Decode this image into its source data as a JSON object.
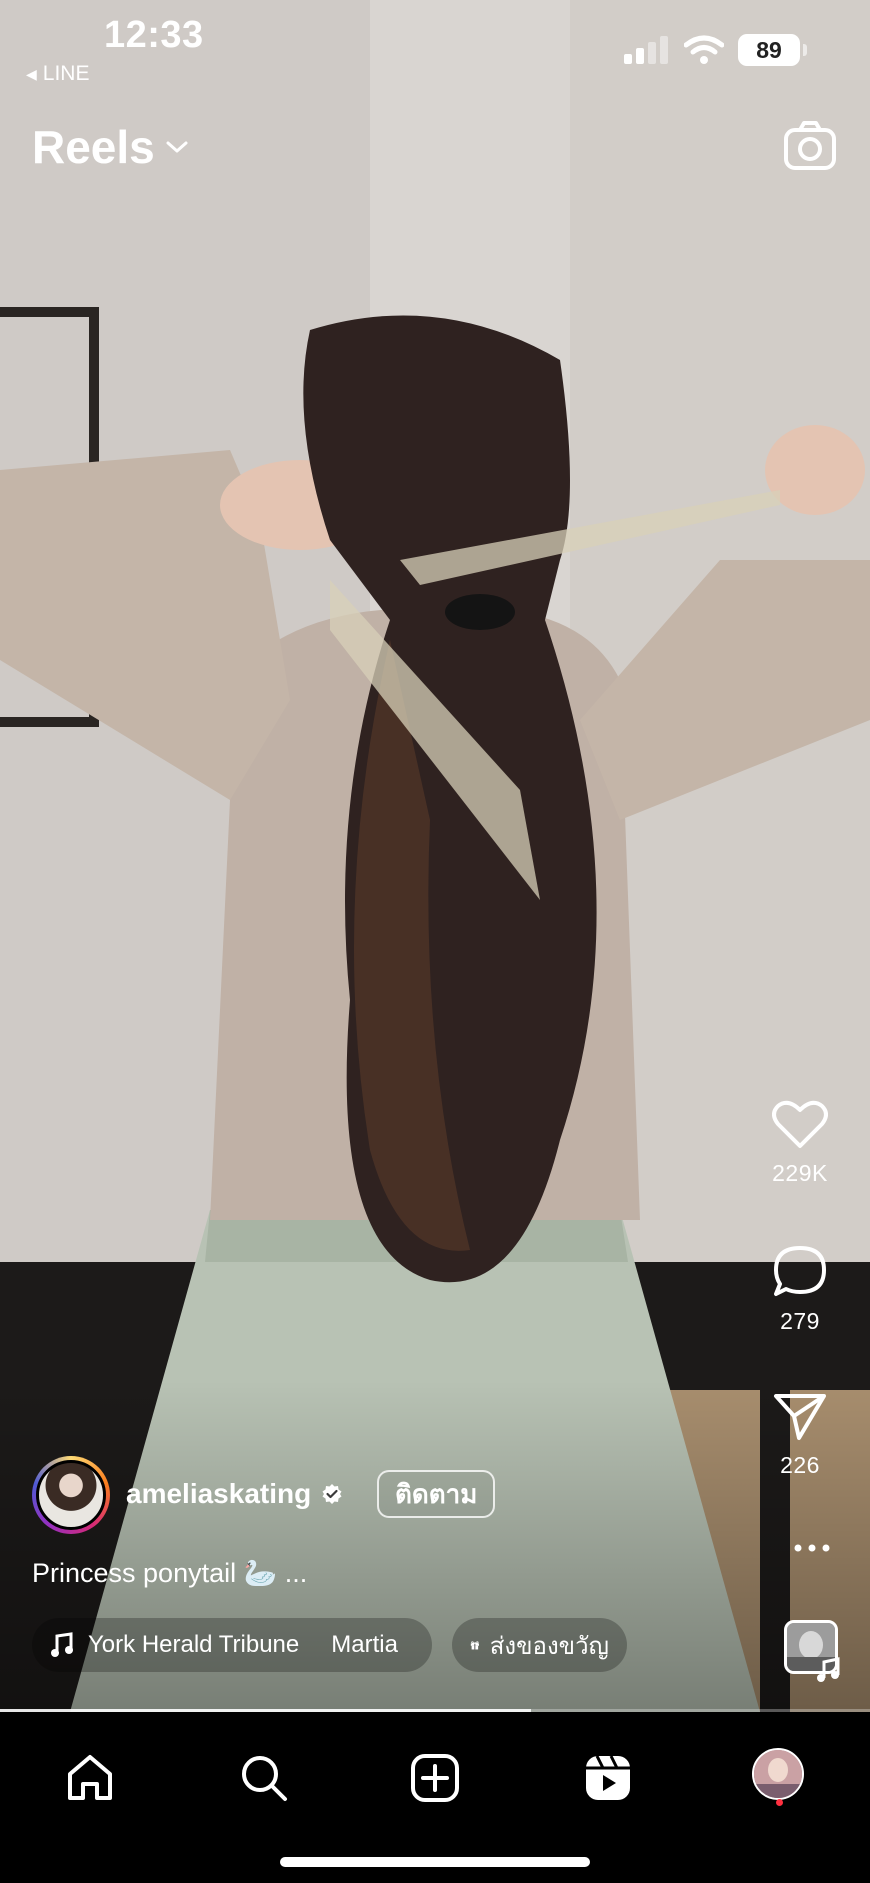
{
  "status_bar": {
    "time": "12:33",
    "back_app": "LINE",
    "battery": "89"
  },
  "header": {
    "title": "Reels",
    "camera_icon": "camera-icon"
  },
  "actions": {
    "like_count": "229K",
    "comment_count": "279",
    "share_count": "226"
  },
  "post": {
    "username": "ameliaskating",
    "verified": true,
    "follow_label": "ติดตาม",
    "caption": "Princess ponytail 🦢 ...",
    "music_text_1": "York Herald Tribune",
    "music_text_2": "Martia",
    "gift_label": "ส่งของขวัญ"
  },
  "playback": {
    "progress_fraction": 0.61
  },
  "tabbar": {
    "items": [
      "home",
      "search",
      "create",
      "reels",
      "profile"
    ]
  },
  "colors": {
    "background": "#000000",
    "notification_dot": "#ff3040"
  }
}
